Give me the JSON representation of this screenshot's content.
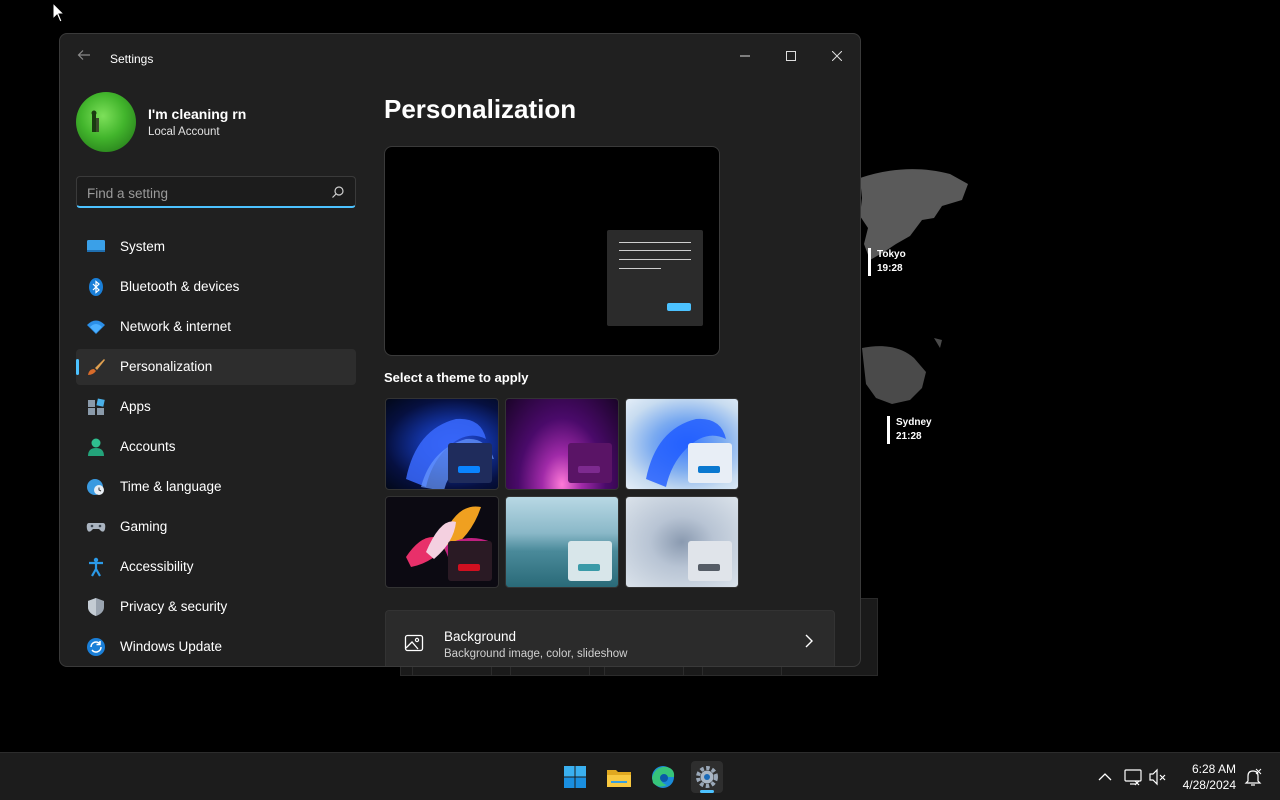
{
  "window": {
    "title": "Settings",
    "controls": {
      "minimize": "—",
      "maximize": "☐",
      "close": "✕"
    }
  },
  "user": {
    "name": "I'm cleaning rn",
    "account_type": "Local Account"
  },
  "search": {
    "placeholder": "Find a setting",
    "value": ""
  },
  "sidebar": {
    "items": [
      {
        "label": "System",
        "icon": "monitor-icon",
        "active": false
      },
      {
        "label": "Bluetooth & devices",
        "icon": "bluetooth-icon",
        "active": false
      },
      {
        "label": "Network & internet",
        "icon": "wifi-icon",
        "active": false
      },
      {
        "label": "Personalization",
        "icon": "paintbrush-icon",
        "active": true
      },
      {
        "label": "Apps",
        "icon": "apps-icon",
        "active": false
      },
      {
        "label": "Accounts",
        "icon": "person-icon",
        "active": false
      },
      {
        "label": "Time & language",
        "icon": "globe-clock-icon",
        "active": false
      },
      {
        "label": "Gaming",
        "icon": "gamepad-icon",
        "active": false
      },
      {
        "label": "Accessibility",
        "icon": "accessibility-icon",
        "active": false
      },
      {
        "label": "Privacy & security",
        "icon": "shield-icon",
        "active": false
      },
      {
        "label": "Windows Update",
        "icon": "update-icon",
        "active": false
      }
    ]
  },
  "main": {
    "title": "Personalization",
    "themes_label": "Select a theme to apply",
    "themes": [
      {
        "name": "windows-dark-bloom",
        "chip": "#1f2c5c",
        "button": "#0a84ff"
      },
      {
        "name": "glow",
        "chip": "#5a1466",
        "button": "#7d2a8f"
      },
      {
        "name": "windows-light-bloom",
        "chip": "#e8eef6",
        "button": "#0a78d0"
      },
      {
        "name": "captured-motion",
        "chip": "#2a1a24",
        "button": "#d01020"
      },
      {
        "name": "sunrise",
        "chip": "#d8e6ea",
        "button": "#3a9aa8"
      },
      {
        "name": "flow",
        "chip": "#e0e4ea",
        "button": "#555c66"
      }
    ],
    "card": {
      "title": "Background",
      "subtitle": "Background image, color, slideshow"
    }
  },
  "widget": {
    "tokyo": {
      "city": "Tokyo",
      "time": "19:28"
    },
    "sydney": {
      "city": "Sydney",
      "time": "21:28"
    }
  },
  "taskbar": {
    "apps": [
      "windows-start-icon",
      "file-explorer-icon",
      "edge-icon",
      "settings-icon"
    ],
    "time": "6:28 AM",
    "date": "4/28/2024"
  },
  "colors": {
    "accent": "#4cc2ff",
    "window_bg": "#202020",
    "card_bg": "#2b2b2b"
  }
}
